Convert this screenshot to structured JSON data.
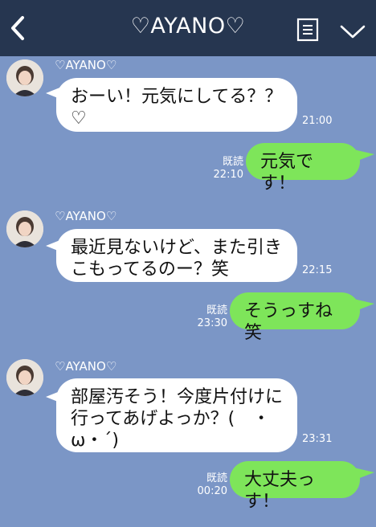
{
  "header": {
    "title": "♡AYANO♡"
  },
  "messages": [
    {
      "sender": "♡AYANO♡",
      "text": "おーい！元気にしてる？？♡",
      "time": "21:00"
    },
    {
      "read": "既読",
      "time": "22:10",
      "text": "元気です！"
    },
    {
      "sender": "♡AYANO♡",
      "text": "最近見ないけど、また引きこもってるのー？笑",
      "time": "22:15"
    },
    {
      "read": "既読",
      "time": "23:30",
      "text": "そうっすね笑"
    },
    {
      "sender": "♡AYANO♡",
      "text": "部屋汚そう！今度片付けに行ってあげよっか？(　・ω・´)",
      "time": "23:31"
    },
    {
      "read": "既読",
      "time": "00:20",
      "text": "大丈夫っす！"
    }
  ],
  "colors": {
    "header_bg": "#263650",
    "chat_bg": "#7b96c6",
    "incoming": "#ffffff",
    "outgoing": "#7ee55a"
  },
  "icons": {
    "back": "chevron-left-icon",
    "menu": "document-list-icon",
    "toggle": "chevron-down-icon"
  }
}
